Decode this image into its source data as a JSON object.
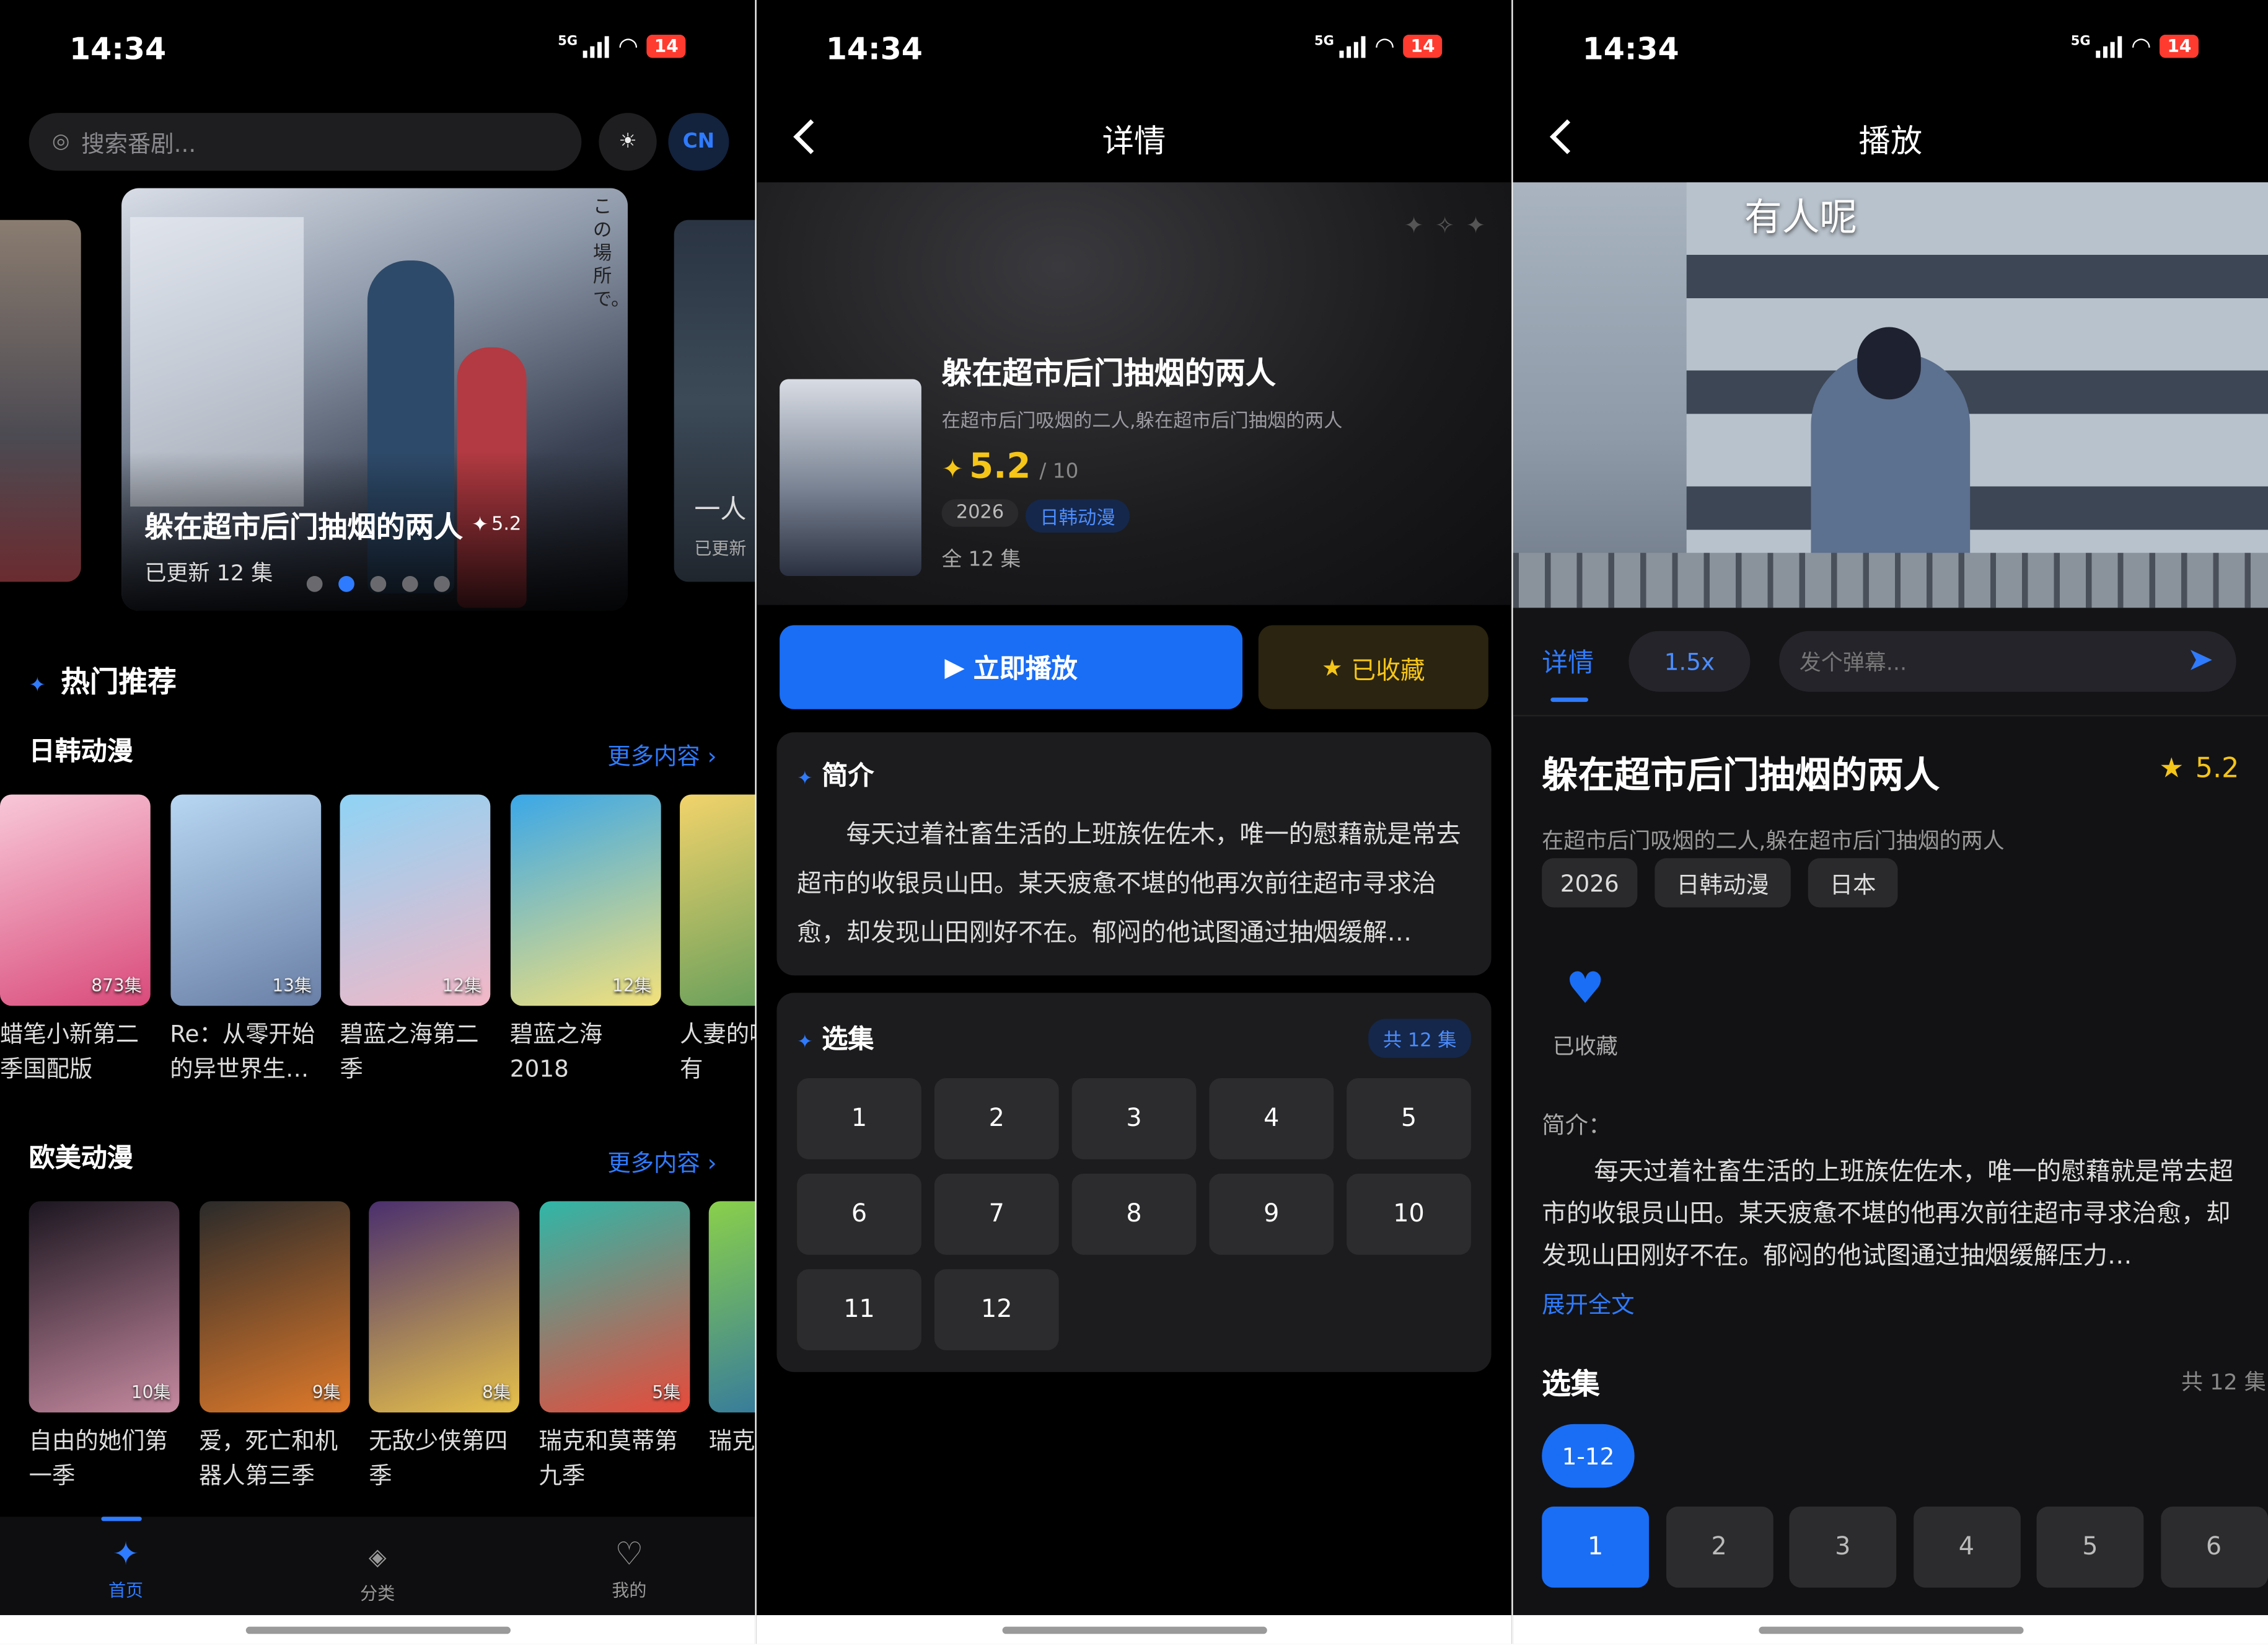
{
  "status": {
    "time": "14:34",
    "network": "5G",
    "battery": "14"
  },
  "home": {
    "search_placeholder": "搜索番剧...",
    "lang_button": "CN",
    "banner": {
      "title": "躲在超市后门抽烟的两人",
      "rating": "5.2",
      "updated": "已更新 12 集",
      "side_text": "この場所で。",
      "side_next_title": "一人",
      "side_next_sub": "已更新"
    },
    "hot_title": "热门推荐",
    "sections": [
      {
        "title": "日韩动漫",
        "more": "更多内容 ›",
        "items": [
          {
            "title": "蜡笔小新第二季国配版",
            "badge": "873集",
            "colors": [
              "#f8c8d8",
              "#d94a7a"
            ]
          },
          {
            "title": "Re：从零开始的异世界生…",
            "badge": "13集",
            "colors": [
              "#b7d7f2",
              "#6a7fa6"
            ]
          },
          {
            "title": "碧蓝之海第二季",
            "badge": "12集",
            "colors": [
              "#8fd3f5",
              "#f3b7c6"
            ]
          },
          {
            "title": "碧蓝之海2018",
            "badge": "12集",
            "colors": [
              "#3aa7e8",
              "#f4e17a"
            ]
          },
          {
            "title": "人妻的嘴起来有",
            "badge": "",
            "colors": [
              "#f2d36b",
              "#5a9a5a"
            ]
          }
        ]
      },
      {
        "title": "欧美动漫",
        "more": "更多内容 ›",
        "items": [
          {
            "title": "自由的她们第一季",
            "badge": "10集",
            "colors": [
              "#1b1620",
              "#c78aa0"
            ]
          },
          {
            "title": "爱，死亡和机器人第三季",
            "badge": "9集",
            "colors": [
              "#2a2a2a",
              "#e07a2a"
            ]
          },
          {
            "title": "无敌少侠第四季",
            "badge": "8集",
            "colors": [
              "#4a2f6e",
              "#e8c24a"
            ]
          },
          {
            "title": "瑞克和莫蒂第九季",
            "badge": "5集",
            "colors": [
              "#2fb7a8",
              "#e84a3a"
            ]
          },
          {
            "title": "瑞克和二季",
            "badge": "",
            "colors": [
              "#8ad04a",
              "#2a6fa8"
            ]
          }
        ]
      }
    ],
    "tabs": [
      {
        "label": "首页",
        "icon": "sparkle-icon"
      },
      {
        "label": "分类",
        "icon": "category-icon"
      },
      {
        "label": "我的",
        "icon": "heart-icon"
      }
    ]
  },
  "detail": {
    "page_title": "详情",
    "title": "躲在超市后门抽烟的两人",
    "alt_title": "在超市后门吸烟的二人,躲在超市后门抽烟的两人",
    "rating": "5.2",
    "rating_max": "/ 10",
    "year": "2026",
    "category": "日韩动漫",
    "episodes": "全 12 集",
    "play_label": "立即播放",
    "fav_label": "已收藏",
    "intro_title": "简介",
    "intro_text": "每天过着社畜生活的上班族佐佐木，唯一的慰藉就是常去超市的收银员山田。某天疲惫不堪的他再次前往超市寻求治愈，却发现山田刚好不在。郁闷的他试图通过抽烟缓解…",
    "episode_title": "选集",
    "episode_count": "共 12 集",
    "episode_list": [
      "1",
      "2",
      "3",
      "4",
      "5",
      "6",
      "7",
      "8",
      "9",
      "10",
      "11",
      "12"
    ]
  },
  "player": {
    "page_title": "播放",
    "subtitle_text": "有人呢",
    "tab_detail": "详情",
    "speed": "1.5x",
    "danmaku_placeholder": "发个弹幕...",
    "title": "躲在超市后门抽烟的两人",
    "rating": "5.2",
    "alt_title": "在超市后门吸烟的二人,躲在超市后门抽烟的两人",
    "tags": [
      "2026",
      "日韩动漫",
      "日本"
    ],
    "fav_label": "已收藏",
    "intro_label": "简介：",
    "intro_text": "每天过着社畜生活的上班族佐佐木，唯一的慰藉就是常去超市的收银员山田。某天疲惫不堪的他再次前往超市寻求治愈，却发现山田刚好不在。郁闷的他试图通过抽烟缓解压力…",
    "expand_label": "展开全文",
    "episode_title": "选集",
    "episode_count": "共 12 集",
    "range_label": "1-12",
    "episode_list": [
      "1",
      "2",
      "3",
      "4",
      "5",
      "6"
    ]
  },
  "colors": {
    "accent": "#1a6ef5",
    "gold": "#f5c518",
    "card": "#1c1c1e"
  }
}
